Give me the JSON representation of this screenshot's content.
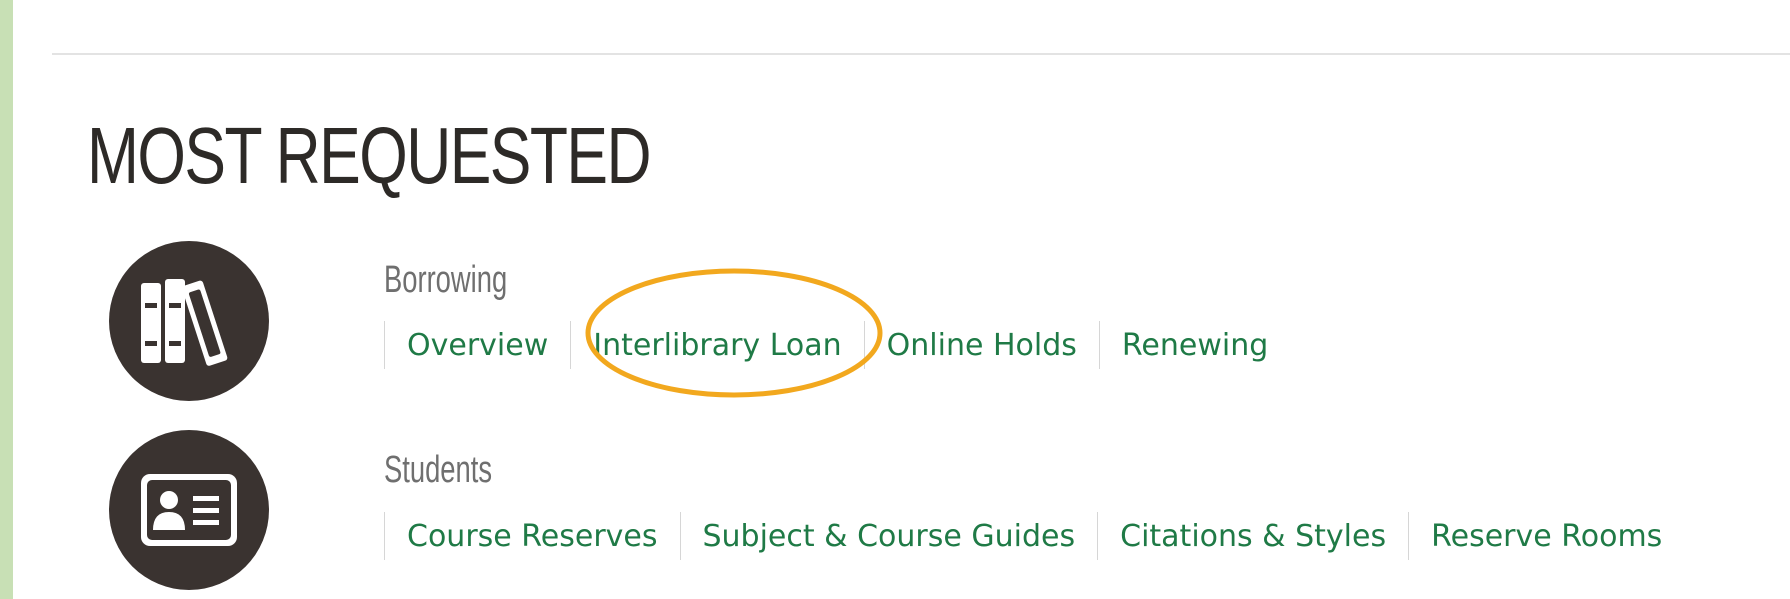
{
  "section": {
    "title": "MOST REQUESTED"
  },
  "categories": [
    {
      "icon": "books-icon",
      "heading": "Borrowing",
      "links": [
        "Overview",
        "Interlibrary Loan",
        "Online Holds",
        "Renewing"
      ]
    },
    {
      "icon": "id-card-icon",
      "heading": "Students",
      "links": [
        "Course Reserves",
        "Subject & Course Guides",
        "Citations & Styles",
        "Reserve Rooms"
      ]
    }
  ],
  "annotation": {
    "highlighted_link": "Interlibrary Loan",
    "highlight_color": "#f2a81e"
  },
  "colors": {
    "link": "#1f7a46",
    "heading": "#6f6f6f",
    "title": "#2d2a27",
    "icon_bg": "#3a3330",
    "frame": "#c8e0b5"
  }
}
